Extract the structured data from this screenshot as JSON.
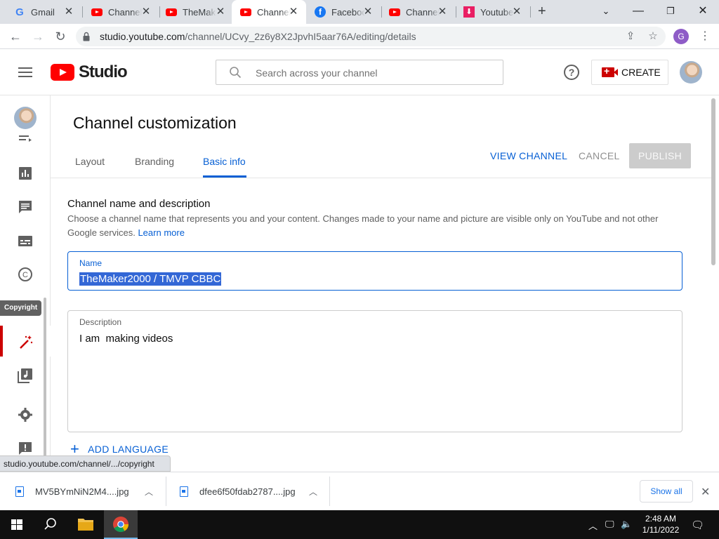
{
  "browser": {
    "tabs": [
      {
        "title": "Gmail",
        "favicon": "gmail-icon"
      },
      {
        "title": "Channel",
        "favicon": "youtube-icon"
      },
      {
        "title": "TheMaker",
        "favicon": "youtube-icon"
      },
      {
        "title": "Channel",
        "favicon": "youtube-icon",
        "active": true
      },
      {
        "title": "Facebook",
        "favicon": "facebook-icon"
      },
      {
        "title": "Channel",
        "favicon": "youtube-icon"
      },
      {
        "title": "Youtube",
        "favicon": "download-icon"
      }
    ],
    "new_tab": "+",
    "url_host": "studio.youtube.com",
    "url_path": "/channel/UCvy_2z6y8X2JpvhI5aar76A/editing/details",
    "profile_initial": "G",
    "status_url": "studio.youtube.com/channel/.../copyright"
  },
  "studio": {
    "logo_text": "Studio",
    "search_placeholder": "Search across your channel",
    "help": "?",
    "create_label": "CREATE"
  },
  "nav": {
    "tooltip": "Copyright",
    "items": [
      "playlists",
      "analytics",
      "comments",
      "subtitles",
      "copyright",
      "earn",
      "audio-library",
      "settings",
      "feedback"
    ],
    "active": "earn"
  },
  "page": {
    "title": "Channel customization",
    "tabs": [
      "Layout",
      "Branding",
      "Basic info"
    ],
    "active_tab": "Basic info",
    "view_channel": "VIEW CHANNEL",
    "cancel": "CANCEL",
    "publish": "PUBLISH",
    "section_title": "Channel name and description",
    "section_desc": "Choose a channel name that represents you and your content. Changes made to your name and picture are visible only on YouTube and not other Google services.",
    "learn_more": "Learn more",
    "name_label": "Name",
    "name_value": "TheMaker2000 / TMVP CBBC",
    "description_label": "Description",
    "description_value": "I am  making videos",
    "add_language": "ADD LANGUAGE"
  },
  "downloads": {
    "items": [
      {
        "filename": "MV5BYmNiN2M4....jpg"
      },
      {
        "filename": "dfee6f50fdab2787....jpg"
      }
    ],
    "show_all": "Show all"
  },
  "taskbar": {
    "time": "2:48 AM",
    "date": "1/11/2022"
  },
  "colors": {
    "accent_blue": "#065fd4",
    "youtube_red": "#ff0000",
    "active_nav_red": "#cc0000",
    "publish_disabled": "#cccccc"
  }
}
